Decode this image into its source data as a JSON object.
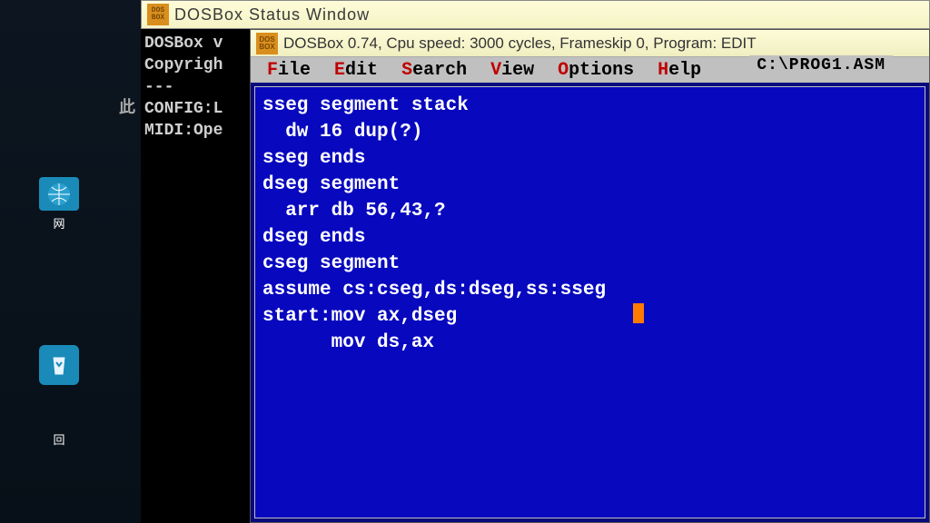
{
  "status_window": {
    "title": "DOSBox Status Window"
  },
  "bg_console": {
    "line1": "DOSBox v",
    "line2": "Copyrigh",
    "line3": "---",
    "line4": "CONFIG:L",
    "line5": "MIDI:Ope"
  },
  "edit_win": {
    "title": "DOSBox 0.74, Cpu speed:    3000 cycles, Frameskip  0, Program:    EDIT",
    "filepath": "C:\\PROG1.ASM"
  },
  "menu": {
    "file": {
      "hot": "F",
      "rest": "ile"
    },
    "edit": {
      "hot": "E",
      "rest": "dit"
    },
    "search": {
      "hot": "S",
      "rest": "earch"
    },
    "view": {
      "hot": "V",
      "rest": "iew"
    },
    "options": {
      "hot": "O",
      "rest": "ptions"
    },
    "help": {
      "hot": "H",
      "rest": "elp"
    }
  },
  "code": {
    "l1": "sseg segment stack",
    "l2": "  dw 16 dup(?)",
    "l3": "sseg ends",
    "l4": "dseg segment",
    "l5": "  arr db 56,43,?",
    "l6": "dseg ends",
    "l7": "cseg segment",
    "l8": "assume cs:cseg,ds:dseg,ss:sseg",
    "l9": "start:mov ax,dseg",
    "l10": "      mov ds,ax"
  },
  "desktop": {
    "label1": "网",
    "label2": "回"
  },
  "bg_prefix": "此"
}
